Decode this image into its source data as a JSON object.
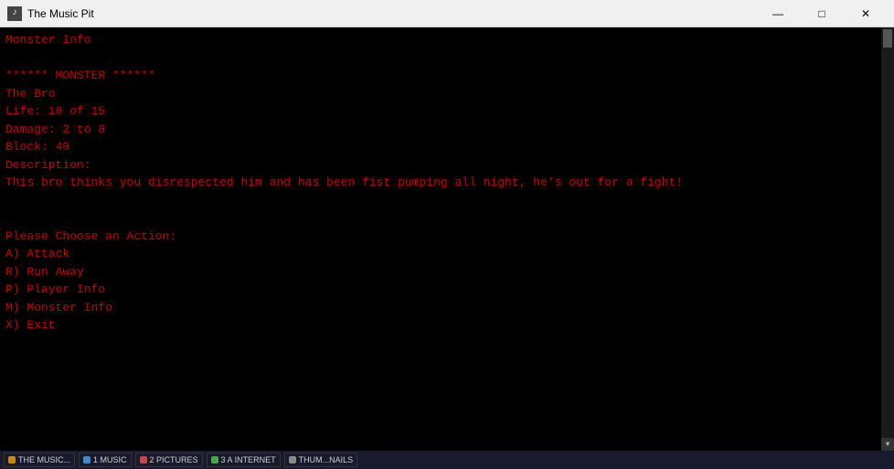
{
  "window": {
    "title": "The Music Pit",
    "icon_label": "♪"
  },
  "titlebar": {
    "minimize_label": "—",
    "maximize_label": "□",
    "close_label": "✕"
  },
  "terminal": {
    "section_title": "Monster Info",
    "monster_header": "****** MONSTER ******",
    "monster_name": "The Bro",
    "life": "Life: 10 of 15",
    "damage": "Damage: 2 to 8",
    "block": "Block: 40",
    "description_label": "Description:",
    "description_text": "This bro thinks you disrespected him and has been fist pumping all night, he's out for a fight!",
    "prompt": "Please Choose an Action:",
    "action_a": "A) Attack",
    "action_r": "R) Run Away",
    "action_p": "P) Player Info",
    "action_m": "M) Monster Info",
    "action_x": "X) Exit"
  },
  "taskbar": {
    "items": [
      {
        "label": "THE MUSIC...",
        "color": "#cc8800"
      },
      {
        "label": "1 MUSIC",
        "color": "#4488cc"
      },
      {
        "label": "2 PICTURES",
        "color": "#cc4444"
      },
      {
        "label": "3 A INTERNET",
        "color": "#44aa44"
      },
      {
        "label": "THUM...NAILS",
        "color": "#888888"
      }
    ]
  }
}
